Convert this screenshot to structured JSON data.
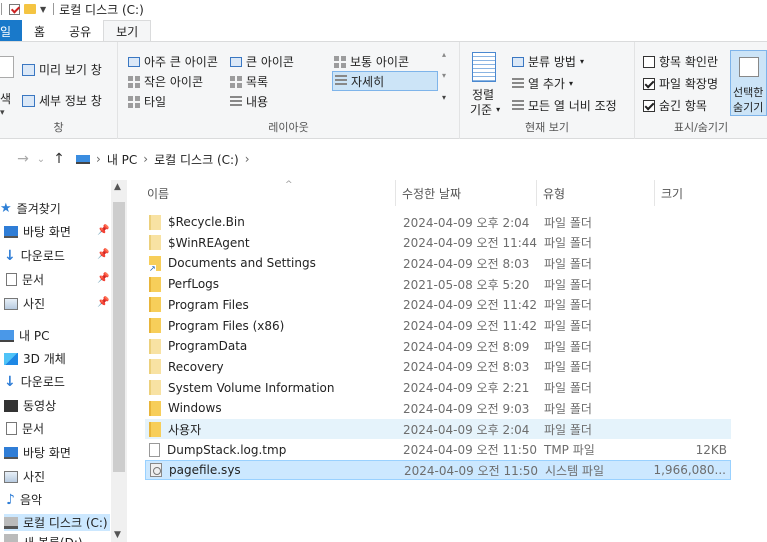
{
  "window": {
    "title": "로컬 디스크 (C:)"
  },
  "tabs": {
    "file": "일",
    "home": "홈",
    "share": "공유",
    "view": "보기"
  },
  "ribbon": {
    "pane": {
      "preview": "미리 보기 창",
      "details": "세부 정보 창",
      "left_cut": "색",
      "label": "창"
    },
    "layout": {
      "items": [
        "아주 큰 아이콘",
        "큰 아이콘",
        "보통 아이콘",
        "작은 아이콘",
        "목록",
        "자세히",
        "타일",
        "내용"
      ],
      "label": "레이아웃"
    },
    "current_view": {
      "sort_line1": "정렬",
      "sort_line2": "기준",
      "group_by": "분류 방법",
      "add_column": "열 추가",
      "fit_columns": "모든 열 너비 조정",
      "label": "현재 보기"
    },
    "show_hide": {
      "item_checkboxes": {
        "label": "항목 확인란",
        "checked": false
      },
      "file_extensions": {
        "label": "파일 확장명",
        "checked": true
      },
      "hidden_items": {
        "label": "숨긴 항목",
        "checked": true
      },
      "hide_selected_line1": "선택한",
      "hide_selected_line2": "숨기기",
      "label": "표시/숨기기"
    }
  },
  "address": {
    "breadcrumb": [
      "내 PC",
      "로컬 디스크 (C:)"
    ]
  },
  "nav": {
    "quick_access": "즐겨찾기",
    "quick_items": [
      "바탕 화면",
      "다운로드",
      "문서",
      "사진"
    ],
    "this_pc": "내 PC",
    "pc_items": [
      "3D 개체",
      "다운로드",
      "동영상",
      "문서",
      "바탕 화면",
      "사진",
      "음악",
      "로컬 디스크 (C:)"
    ],
    "partial_bottom": "새 볼륨(D:)"
  },
  "columns": {
    "name": "이름",
    "date": "수정한 날짜",
    "type": "유형",
    "size": "크기"
  },
  "files": [
    {
      "name": "$Recycle.Bin",
      "date": "2024-04-09 오후 2:04",
      "type": "파일 폴더",
      "size": "",
      "icon": "folder-pale"
    },
    {
      "name": "$WinREAgent",
      "date": "2024-04-09 오전 11:44",
      "type": "파일 폴더",
      "size": "",
      "icon": "folder-pale"
    },
    {
      "name": "Documents and Settings",
      "date": "2024-04-09 오전 8:03",
      "type": "파일 폴더",
      "size": "",
      "icon": "folder-link"
    },
    {
      "name": "PerfLogs",
      "date": "2021-05-08 오후 5:20",
      "type": "파일 폴더",
      "size": "",
      "icon": "folder"
    },
    {
      "name": "Program Files",
      "date": "2024-04-09 오전 11:42",
      "type": "파일 폴더",
      "size": "",
      "icon": "folder"
    },
    {
      "name": "Program Files (x86)",
      "date": "2024-04-09 오전 11:42",
      "type": "파일 폴더",
      "size": "",
      "icon": "folder"
    },
    {
      "name": "ProgramData",
      "date": "2024-04-09 오전 8:09",
      "type": "파일 폴더",
      "size": "",
      "icon": "folder-pale"
    },
    {
      "name": "Recovery",
      "date": "2024-04-09 오전 8:03",
      "type": "파일 폴더",
      "size": "",
      "icon": "folder-pale"
    },
    {
      "name": "System Volume Information",
      "date": "2024-04-09 오후 2:21",
      "type": "파일 폴더",
      "size": "",
      "icon": "folder-pale"
    },
    {
      "name": "Windows",
      "date": "2024-04-09 오전 9:03",
      "type": "파일 폴더",
      "size": "",
      "icon": "folder"
    },
    {
      "name": "사용자",
      "date": "2024-04-09 오후 2:04",
      "type": "파일 폴더",
      "size": "",
      "icon": "folder"
    },
    {
      "name": "DumpStack.log.tmp",
      "date": "2024-04-09 오전 11:50",
      "type": "TMP 파일",
      "size": "12KB",
      "icon": "file"
    },
    {
      "name": "pagefile.sys",
      "date": "2024-04-09 오전 11:50",
      "type": "시스템 파일",
      "size": "1,966,080...",
      "icon": "sys"
    }
  ],
  "state": {
    "hovered_row": 10,
    "selected_row": 12
  }
}
